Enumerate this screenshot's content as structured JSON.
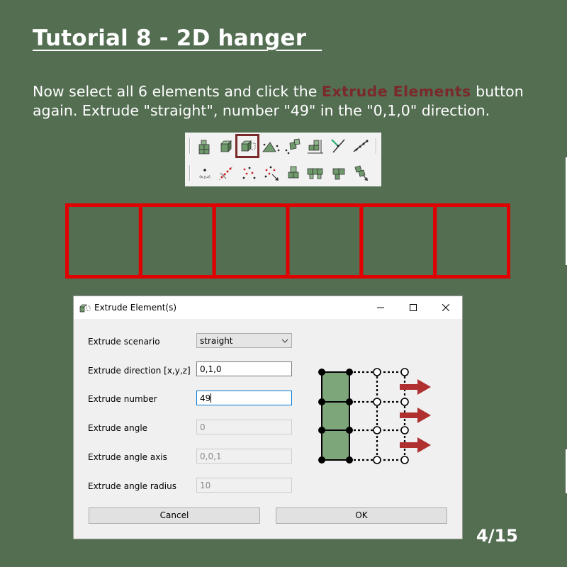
{
  "slide": {
    "title": "Tutorial 8 - 2D hanger  ",
    "instruction": {
      "before": "Now select all 6 elements and click the ",
      "highlight": "Extrude Elements",
      "after": " button again. Extrude \"straight\", number \"49\" in the \"0,1,0\" direction."
    },
    "page_indicator": "4/15"
  },
  "colors": {
    "background": "#546e52",
    "highlight": "#7a2a2a",
    "element_outline": "#e00000",
    "element_fill": "#7da67a",
    "arrow": "#b03030"
  },
  "toolbar": {
    "row1_icons": [
      "extrude-nodes-icon",
      "extrude-cube-icon",
      "extrude-elements-icon",
      "revolve-icon",
      "copy-nodes-icon",
      "sweep-icon",
      "mirror-icon",
      "line-icon",
      "divide-line-icon"
    ],
    "row2_icons": [
      "node-coords-icon",
      "nodes-along-line-icon",
      "scatter-nodes-icon",
      "move-nodes-icon",
      "split-elements-icon",
      "merge-elements-icon",
      "rotate-elements-icon",
      "drag-elements-icon"
    ],
    "selected_icon": "extrude-elements-icon"
  },
  "elements_count": 6,
  "dialog": {
    "title": "Extrude Element(s)",
    "fields": {
      "scenario": {
        "label": "Extrude scenario",
        "value": "straight"
      },
      "direction": {
        "label": "Extrude direction [x,y,z]",
        "value": "0,1,0"
      },
      "number": {
        "label": "Extrude number",
        "value": "49"
      },
      "angle": {
        "label": "Extrude angle",
        "value": "0"
      },
      "angle_axis": {
        "label": "Extrude angle axis",
        "value": "0,0,1"
      },
      "angle_radius": {
        "label": "Extrude angle radius",
        "value": "10"
      }
    },
    "cancel_label": "Cancel",
    "ok_label": "OK"
  }
}
